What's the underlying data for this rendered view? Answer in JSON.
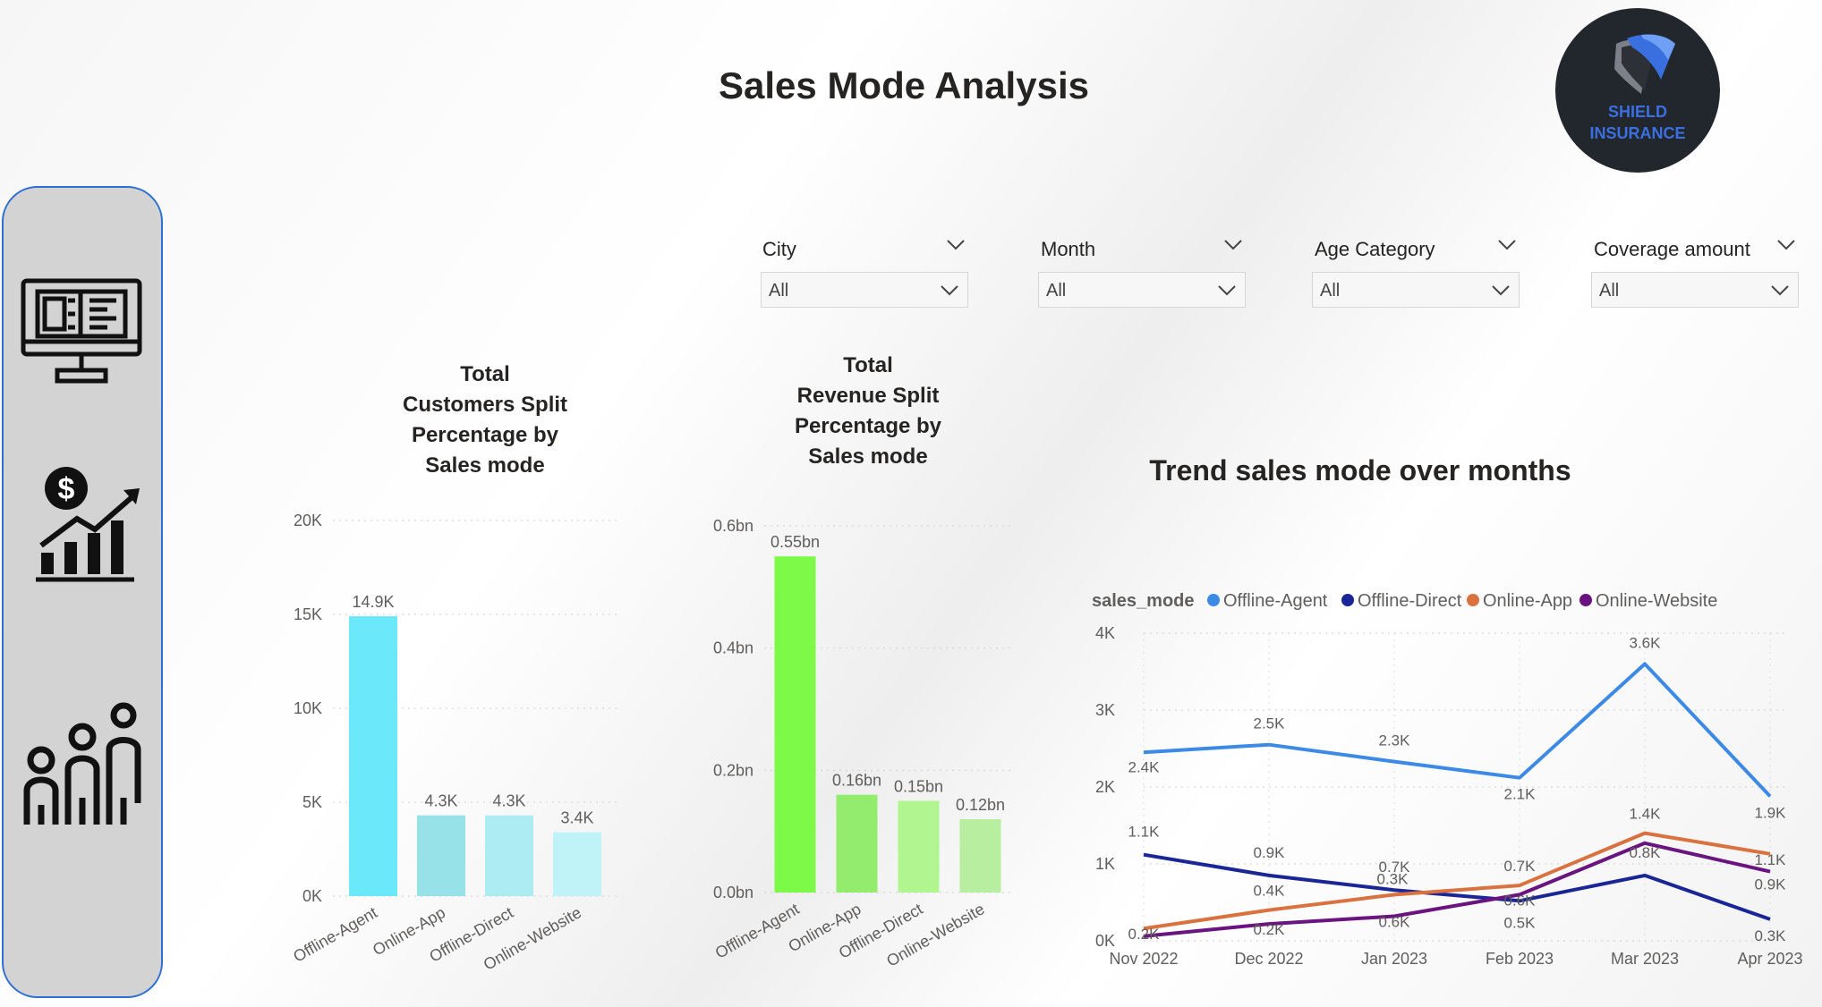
{
  "page_title": "Sales Mode Analysis",
  "logo": {
    "line1": "SHIELD",
    "line2": "INSURANCE"
  },
  "nav": [
    {
      "icon": "monitor-dashboard-icon"
    },
    {
      "icon": "dollar-growth-chart-icon"
    },
    {
      "icon": "family-icon"
    }
  ],
  "filters": [
    {
      "label": "City",
      "value": "All"
    },
    {
      "label": "Month",
      "value": "All"
    },
    {
      "label": "Age Category",
      "value": "All"
    },
    {
      "label": "Coverage amount",
      "value": "All"
    }
  ],
  "colors": {
    "customers_bars": [
      "#6be8f9",
      "#97e1e8",
      "#acecf2",
      "#bff3f8"
    ],
    "revenue_bars": [
      "#7dfa47",
      "#94ec6e",
      "#b0f590",
      "#b8eea0"
    ],
    "series": [
      "#3d8ae6",
      "#1a2696",
      "#d9723f",
      "#6a1480"
    ]
  },
  "chart_data": [
    {
      "type": "bar",
      "title_lines": [
        "Total",
        "Customers Split",
        "Percentage by",
        "Sales mode"
      ],
      "categories": [
        "Offline-Agent",
        "Online-App",
        "Offline-Direct",
        "Online-Website"
      ],
      "values": [
        14900,
        4300,
        4300,
        3400
      ],
      "data_labels": [
        "14.9K",
        "4.3K",
        "4.3K",
        "3.4K"
      ],
      "yticks": [
        0,
        5000,
        10000,
        15000,
        20000
      ],
      "ytick_labels": [
        "0K",
        "5K",
        "10K",
        "15K",
        "20K"
      ],
      "ylim": [
        0,
        20000
      ],
      "grid": true
    },
    {
      "type": "bar",
      "title_lines": [
        "Total",
        "Revenue Split",
        "Percentage by",
        "Sales mode"
      ],
      "categories": [
        "Offline-Agent",
        "Online-App",
        "Offline-Direct",
        "Online-Website"
      ],
      "values": [
        0.55,
        0.16,
        0.15,
        0.12
      ],
      "data_labels": [
        "0.55bn",
        "0.16bn",
        "0.15bn",
        "0.12bn"
      ],
      "yticks": [
        0,
        0.2,
        0.4,
        0.6
      ],
      "ytick_labels": [
        "0.0bn",
        "0.2bn",
        "0.4bn",
        "0.6bn"
      ],
      "ylim": [
        0,
        0.6
      ],
      "grid": true
    },
    {
      "type": "line",
      "title": "Trend sales mode over months",
      "legend_title": "sales_mode",
      "x": [
        "Nov 2022",
        "Dec 2022",
        "Jan 2023",
        "Feb 2023",
        "Mar 2023",
        "Apr 2023"
      ],
      "yticks": [
        0,
        1000,
        2000,
        3000,
        4000
      ],
      "ytick_labels": [
        "0K",
        "1K",
        "2K",
        "3K",
        "4K"
      ],
      "ylim": [
        0,
        4000
      ],
      "legend_position": "top",
      "grid": true,
      "series": [
        {
          "name": "Offline-Agent",
          "values": [
            2450,
            2550,
            2330,
            2120,
            3600,
            1880
          ],
          "labels": [
            "2.4K",
            "2.5K",
            "2.3K",
            "2.1K",
            "3.6K",
            "1.9K"
          ]
        },
        {
          "name": "Offline-Direct",
          "values": [
            1120,
            850,
            660,
            520,
            850,
            280
          ],
          "labels": [
            "1.1K",
            "0.9K",
            "0.7K",
            "0.5K",
            "0.8K",
            "0.3K"
          ]
        },
        {
          "name": "Online-App",
          "values": [
            160,
            400,
            600,
            720,
            1400,
            1130
          ],
          "labels": [
            "0.2K",
            "0.4K",
            "0.6K",
            "0.7K",
            "1.4K",
            "1.1K"
          ]
        },
        {
          "name": "Online-Website",
          "values": [
            60,
            220,
            320,
            600,
            1270,
            900
          ],
          "labels": [
            "0.1K",
            "0.2K",
            "0.3K",
            "0.6K",
            "1.3K",
            "0.9K"
          ]
        }
      ],
      "printed_labels": [
        {
          "series": 0,
          "i": 0,
          "text": "2.4K"
        },
        {
          "series": 0,
          "i": 1,
          "text": "2.5K"
        },
        {
          "series": 0,
          "i": 2,
          "text": "2.3K"
        },
        {
          "series": 0,
          "i": 3,
          "text": "2.1K"
        },
        {
          "series": 0,
          "i": 4,
          "text": "3.6K"
        },
        {
          "series": 0,
          "i": 5,
          "text": "1.9K"
        },
        {
          "series": 1,
          "i": 0,
          "text": "1.1K"
        },
        {
          "series": 1,
          "i": 1,
          "text": "0.9K"
        },
        {
          "series": 1,
          "i": 2,
          "text": "0.7K"
        },
        {
          "series": 1,
          "i": 3,
          "text": "0.5K"
        },
        {
          "series": 1,
          "i": 4,
          "text": "0.8K"
        },
        {
          "series": 1,
          "i": 5,
          "text": "0.3K"
        },
        {
          "series": 2,
          "i": 0,
          "text": "0.2K"
        },
        {
          "series": 2,
          "i": 1,
          "text": "0.4K"
        },
        {
          "series": 2,
          "i": 2,
          "text": "0.3K"
        },
        {
          "series": 2,
          "i": 3,
          "text": "0.7K"
        },
        {
          "series": 2,
          "i": 4,
          "text": "1.4K"
        },
        {
          "series": 2,
          "i": 5,
          "text": "1.1K"
        },
        {
          "series": 3,
          "i": 1,
          "text": "0.2K"
        },
        {
          "series": 3,
          "i": 2,
          "text": "0.6K"
        },
        {
          "series": 3,
          "i": 3,
          "text": "0.6K"
        },
        {
          "series": 3,
          "i": 5,
          "text": "0.9K"
        }
      ]
    }
  ]
}
